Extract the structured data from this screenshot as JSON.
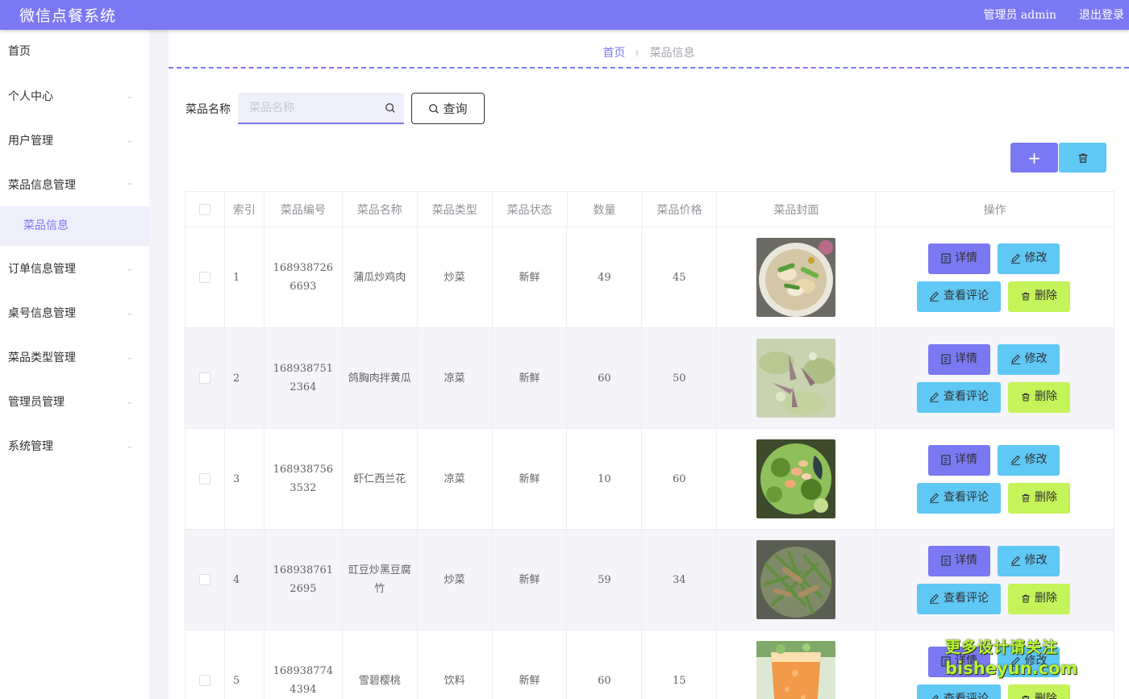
{
  "app": {
    "title": "微信点餐系统"
  },
  "header": {
    "admin_label": "管理员 admin",
    "logout_label": "退出登录"
  },
  "colors": {
    "primary": "#7b78f3",
    "info": "#5fc8f5",
    "success": "#c4f35a",
    "page_bg": "#f4f4f8"
  },
  "sidebar": {
    "items": [
      {
        "label": "首页",
        "expandable": false
      },
      {
        "label": "个人中心",
        "expandable": true
      },
      {
        "label": "用户管理",
        "expandable": true
      },
      {
        "label": "菜品信息管理",
        "expandable": true,
        "expanded": true
      },
      {
        "label": "菜品信息",
        "sub": true,
        "active": true
      },
      {
        "label": "订单信息管理",
        "expandable": true
      },
      {
        "label": "桌号信息管理",
        "expandable": true
      },
      {
        "label": "菜品类型管理",
        "expandable": true
      },
      {
        "label": "管理员管理",
        "expandable": true
      },
      {
        "label": "系统管理",
        "expandable": true
      }
    ]
  },
  "breadcrumb": {
    "home": "首页",
    "current": "菜品信息"
  },
  "search": {
    "label": "菜品名称",
    "placeholder": "菜品名称",
    "value": "",
    "button_label": "查询"
  },
  "toolbar": {
    "add_icon": "plus-icon",
    "delete_icon": "trash-icon"
  },
  "table": {
    "columns": [
      "索引",
      "菜品编号",
      "菜品名称",
      "菜品类型",
      "菜品状态",
      "数量",
      "菜品价格",
      "菜品封面",
      "操作"
    ],
    "rows": [
      {
        "index": "1",
        "code": "1689387266693",
        "name": "蒲瓜炒鸡肉",
        "type": "炒菜",
        "status": "新鲜",
        "qty": "49",
        "price": "45",
        "image": "stir-fried-chicken-with-gourd"
      },
      {
        "index": "2",
        "code": "1689387512364",
        "name": "鸽胸肉拌黄瓜",
        "type": "凉菜",
        "status": "新鲜",
        "qty": "60",
        "price": "50",
        "image": "pigeon-breast-with-cucumber"
      },
      {
        "index": "3",
        "code": "1689387563532",
        "name": "虾仁西兰花",
        "type": "凉菜",
        "status": "新鲜",
        "qty": "10",
        "price": "60",
        "image": "shrimp-broccoli"
      },
      {
        "index": "4",
        "code": "1689387612695",
        "name": "豇豆炒黑豆腐竹",
        "type": "炒菜",
        "status": "新鲜",
        "qty": "59",
        "price": "34",
        "image": "cowpea-with-tofu-skin"
      },
      {
        "index": "5",
        "code": "1689387744394",
        "name": "雪碧樱桃",
        "type": "饮料",
        "status": "新鲜",
        "qty": "60",
        "price": "15",
        "image": "sprite-cherry-drink"
      }
    ],
    "actions": {
      "detail": "详情",
      "edit": "修改",
      "review": "查看评论",
      "delete": "删除"
    }
  },
  "watermark": {
    "line1": "更多设计请关注",
    "line2": "bisheyun.com"
  }
}
